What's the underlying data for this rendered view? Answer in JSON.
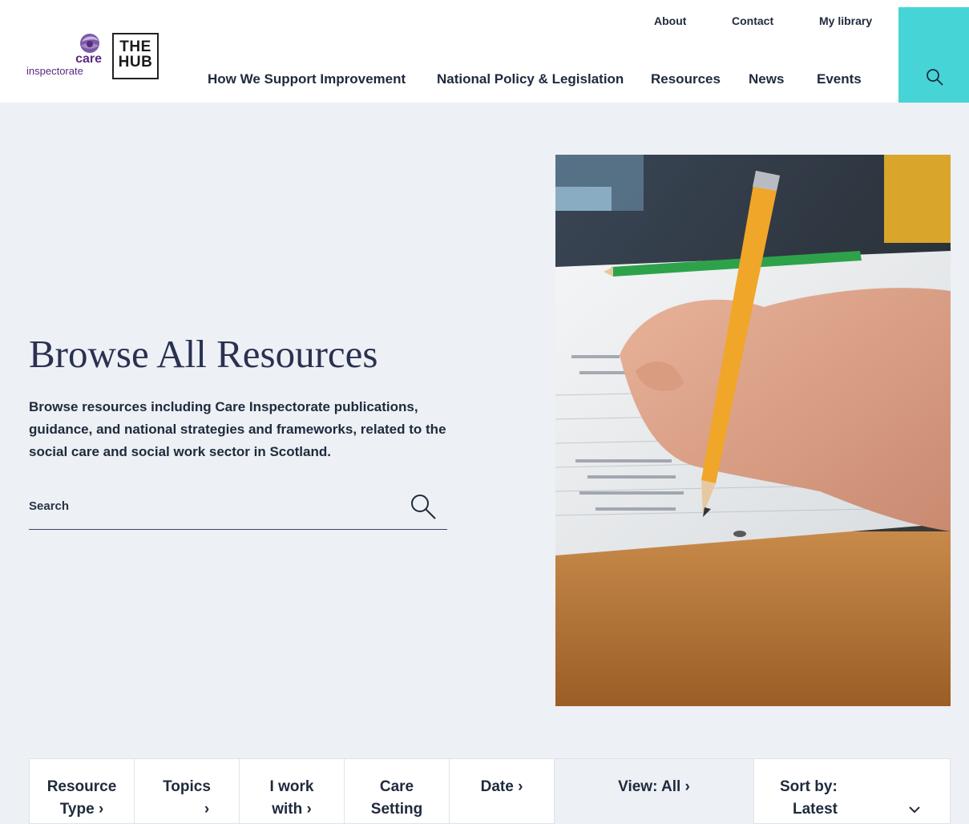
{
  "header": {
    "logo": {
      "care": "care",
      "inspectorate": "inspectorate",
      "hub_line1": "THE",
      "hub_line2": "HUB"
    },
    "utility_nav": [
      "About",
      "Contact",
      "My library"
    ],
    "main_nav": [
      "How We Support Improvement",
      "National Policy & Legislation",
      "Resources",
      "News",
      "Events"
    ],
    "search_button_color": "#46d4d6"
  },
  "hero": {
    "title": "Browse All Resources",
    "description": "Browse resources including Care Inspectorate publications, guidance, and national strategies and frameworks, related to the social care and social work sector in Scotland.",
    "search_placeholder": "Search",
    "image_subject": "hand writing with pencil on notepad"
  },
  "filters": [
    {
      "line1": "Resource",
      "line2": "Type",
      "chevron": "›"
    },
    {
      "line1": "Topics",
      "line2": "",
      "chevron": "›"
    },
    {
      "line1": "I work",
      "line2": "with",
      "chevron": "›"
    },
    {
      "line1": "Care",
      "line2": "Setting",
      "chevron": ""
    },
    {
      "line1": "Date",
      "line2": "",
      "chevron": "›"
    }
  ],
  "view": {
    "label": "View: All",
    "chevron": "›"
  },
  "sort": {
    "label": "Sort by:",
    "value": "Latest",
    "chevron": "⌄"
  },
  "colors": {
    "accent_teal": "#46d4d6",
    "brand_purple": "#5a2a82",
    "text_navy": "#1f2a3d",
    "hero_bg": "#edf0f5"
  }
}
